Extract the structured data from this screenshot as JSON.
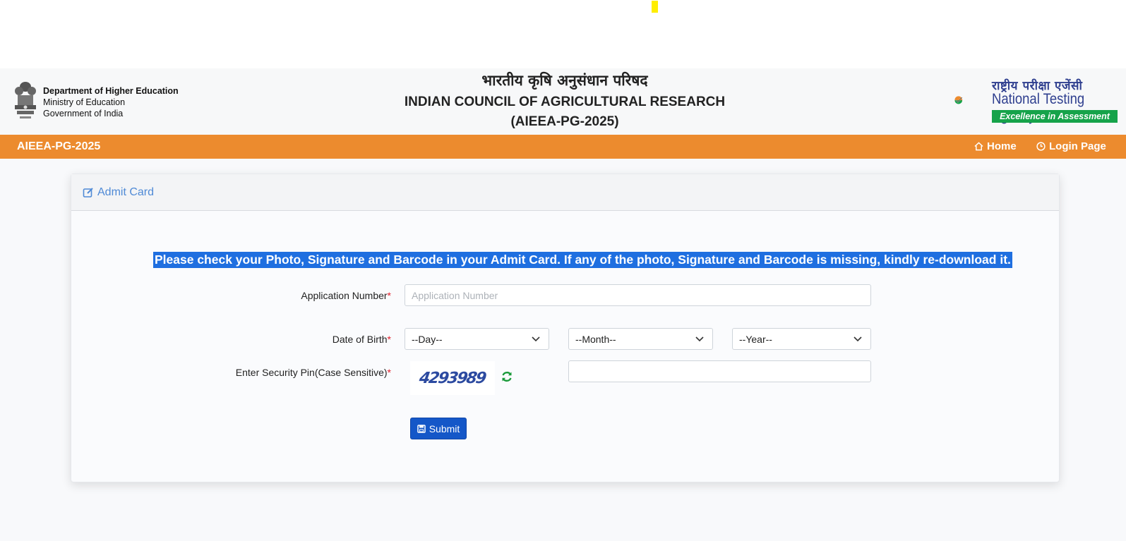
{
  "header": {
    "dept_line1": "Department of Higher Education",
    "dept_line2": "Ministry of Education",
    "dept_line3": "Government of India",
    "title_hindi": "भारतीय कृषि अनुसंधान परिषद",
    "title_english": "INDIAN COUNCIL OF AGRICULTURAL RESEARCH (AIEEA-PG-2025)",
    "nta_hindi": "राष्ट्रीय परीक्षा एजेंसी",
    "nta_english": "National Testing Agency",
    "nta_tagline": "Excellence in Assessment"
  },
  "navbar": {
    "brand": "AIEEA-PG-2025",
    "home_label": "Home",
    "login_label": "Login Page"
  },
  "card": {
    "title": "Admit Card",
    "notice": "Please check your Photo, Signature and Barcode in your Admit Card. If any of the photo, Signature and Barcode is missing, kindly re-download it."
  },
  "form": {
    "app_number_label": "Application Number",
    "app_number_placeholder": "Application Number",
    "dob_label": "Date of Birth",
    "day_selected": "--Day--",
    "month_selected": "--Month--",
    "year_selected": "--Year--",
    "security_label": "Enter Security Pin(Case Sensitive)",
    "captcha_text": "4293989",
    "required_mark": "*",
    "submit_label": "Submit"
  },
  "colors": {
    "navbar": "#ec8b2e",
    "notice_highlight": "#1f6fe0",
    "submit": "#1457c8",
    "refresh_icon": "#1a9a3a"
  }
}
